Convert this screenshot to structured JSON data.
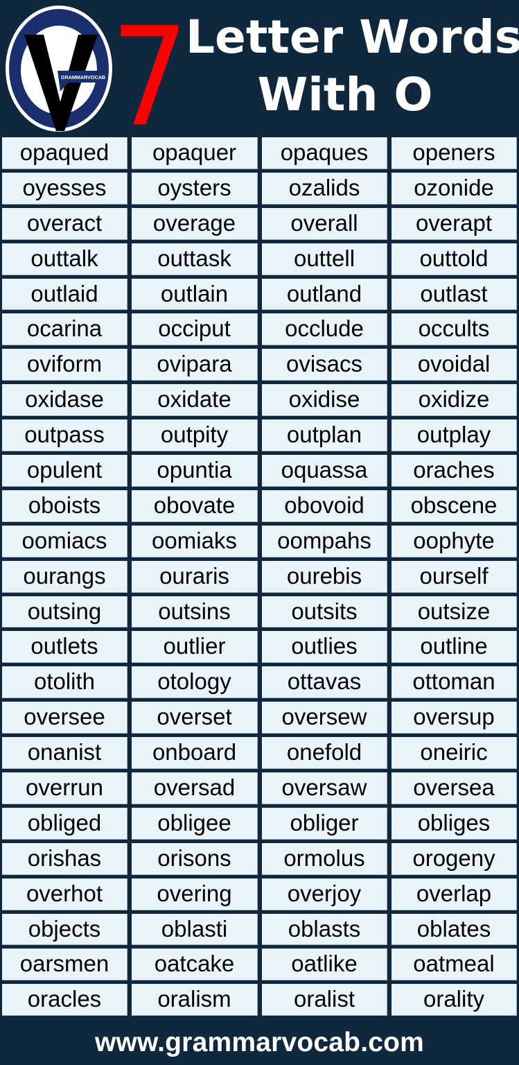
{
  "header": {
    "logo_text": "GRAMMARVOCAB",
    "number": "7",
    "title_line1": "Letter Words",
    "title_line2": "With O"
  },
  "colors": {
    "background": "#10283d",
    "cell": "#e8f4fa",
    "accent_number": "#ff0000",
    "logo_ring": "#1a2f6e",
    "text_on_cell": "#000000",
    "text_on_background": "#ffffff"
  },
  "words": [
    [
      "opaqued",
      "opaquer",
      "opaques",
      "openers"
    ],
    [
      "oyesses",
      "oysters",
      "ozalids",
      "ozonide"
    ],
    [
      "overact",
      "overage",
      "overall",
      "overapt"
    ],
    [
      "outtalk",
      "outtask",
      "outtell",
      "outtold"
    ],
    [
      "outlaid",
      "outlain",
      "outland",
      "outlast"
    ],
    [
      "ocarina",
      "occiput",
      "occlude",
      "occults"
    ],
    [
      "oviform",
      "ovipara",
      "ovisacs",
      "ovoidal"
    ],
    [
      "oxidase",
      "oxidate",
      "oxidise",
      "oxidize"
    ],
    [
      "outpass",
      "outpity",
      "outplan",
      "outplay"
    ],
    [
      "opulent",
      "opuntia",
      "oquassa",
      "oraches"
    ],
    [
      "oboists",
      "obovate",
      "obovoid",
      "obscene"
    ],
    [
      "oomiacs",
      "oomiaks",
      "oompahs",
      "oophyte"
    ],
    [
      "ourangs",
      "ouraris",
      "ourebis",
      "ourself"
    ],
    [
      "outsing",
      "outsins",
      "outsits",
      "outsize"
    ],
    [
      "outlets",
      "outlier",
      "outlies",
      "outline"
    ],
    [
      "otolith",
      "otology",
      "ottavas",
      "ottoman"
    ],
    [
      "oversee",
      "overset",
      "oversew",
      "oversup"
    ],
    [
      "onanist",
      "onboard",
      "onefold",
      "oneiric"
    ],
    [
      "overrun",
      "oversad",
      "oversaw",
      "oversea"
    ],
    [
      "obliged",
      "obligee",
      "obliger",
      "obliges"
    ],
    [
      "orishas",
      "orisons",
      "ormolus",
      "orogeny"
    ],
    [
      "overhot",
      "overing",
      "overjoy",
      "overlap"
    ],
    [
      "objects",
      "oblasti",
      "oblasts",
      "oblates"
    ],
    [
      "oarsmen",
      "oatcake",
      "oatlike",
      "oatmeal"
    ],
    [
      "oracles",
      "oralism",
      "oralist",
      "orality"
    ]
  ],
  "footer": {
    "website": "www.grammarvocab.com"
  }
}
